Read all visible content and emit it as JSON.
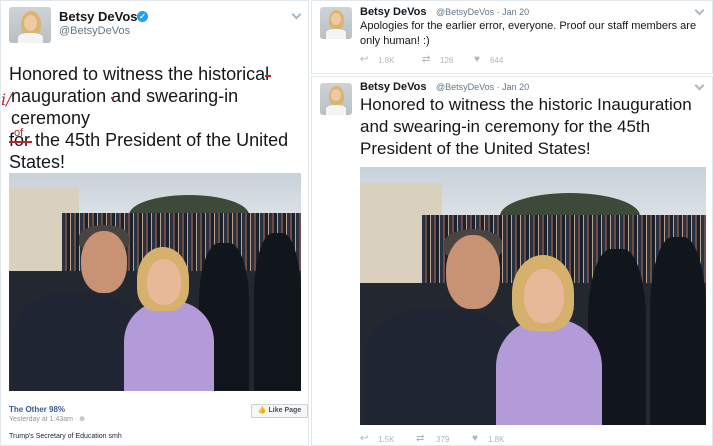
{
  "left_post": {
    "author_name": "Betsy DeVos",
    "author_handle": "@BetsyDeVos",
    "line1": "Honored to witness the historica",
    "line1_strike": "l",
    "line2_pre": "nauguration ",
    "line2_strike": "and swearing-in ceremony",
    "line3_strike": "for",
    "line3_post": " the 45th President of the United",
    "line4": "States!",
    "scribble_i": "i/",
    "scribble_of": "of",
    "page_name": "The Other 98%",
    "post_time": "Yesterday at 1:43am · ",
    "globe_glyph": "⊕",
    "like_page_label": "👍 Like Page",
    "caption": "Trump's Secretary of Education smh"
  },
  "tweet_top": {
    "author_name": "Betsy DeVos",
    "author_handle": "@BetsyDeVos · Jan 20",
    "text": "Apologies for the earlier error, everyone. Proof our staff members are only human! :)",
    "reply_icon": "↩",
    "retweet_icon": "⇄",
    "like_icon": "♥",
    "replies": "1.8K",
    "retweets": "126",
    "likes": "644"
  },
  "tweet_bottom": {
    "author_name": "Betsy DeVos",
    "author_handle": "@BetsyDeVos · Jan 20",
    "text": "Honored to witness the historic Inauguration and swearing-in ceremony for the 45th President of the United States!",
    "reply_icon": "↩",
    "retweet_icon": "⇄",
    "like_icon": "♥",
    "replies": "1.5K",
    "retweets": "379",
    "likes": "1.8K"
  },
  "colors": {
    "correction_red": "#c0232e",
    "verified_blue": "#1da1f2",
    "facebook_link": "#3b5998",
    "action_gray": "#aab8c2"
  }
}
